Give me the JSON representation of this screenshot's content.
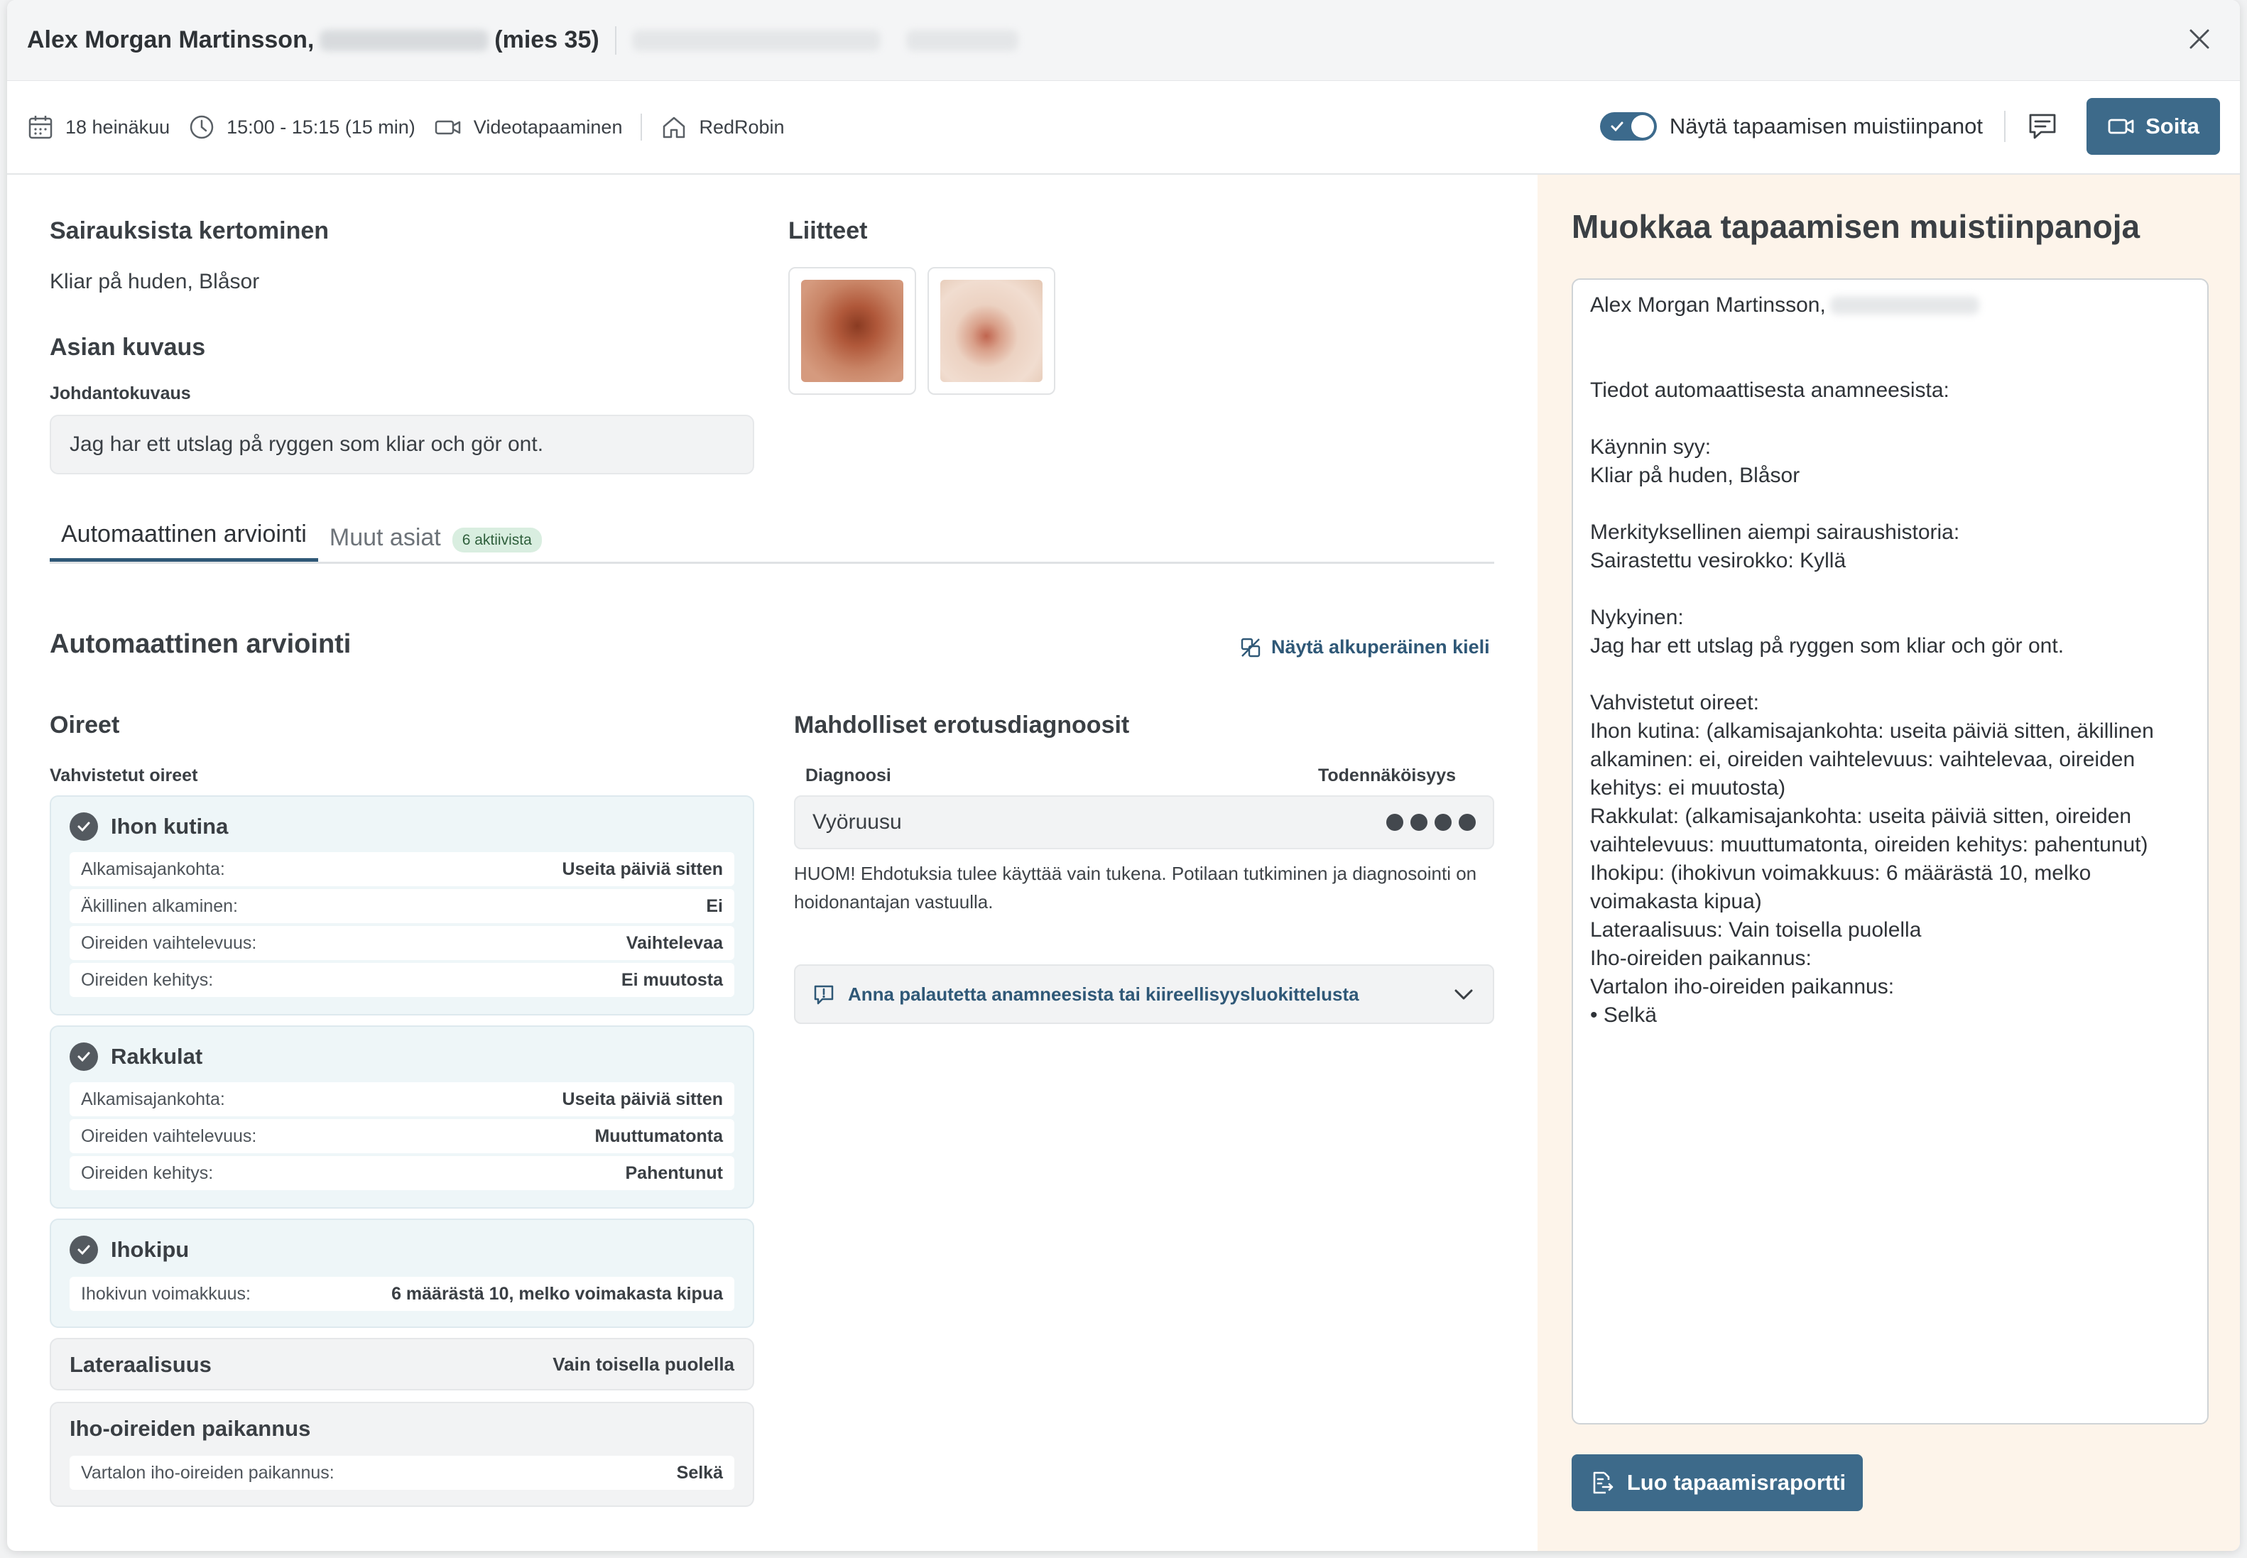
{
  "header": {
    "patient_name": "Alex Morgan Martinsson,",
    "patient_age": "(mies 35)",
    "close_label": "×"
  },
  "meta": {
    "date": "18 heinäkuu",
    "time": "15:00 - 15:15 (15 min)",
    "type": "Videotapaaminen",
    "location": "RedRobin",
    "toggle_label": "Näytä tapaamisen muistiinpanot",
    "toggle_on": true,
    "call_label": "Soita"
  },
  "reason": {
    "title": "Sairauksista kertominen",
    "value": "Kliar på huden, Blåsor"
  },
  "attachments": {
    "title": "Liitteet"
  },
  "description": {
    "title": "Asian kuvaus",
    "intro_label": "Johdantokuvaus",
    "intro_text": "Jag har ett utslag på ryggen som kliar och gör ont."
  },
  "tabs": {
    "active": "Automaattinen arviointi",
    "other": "Muut asiat",
    "badge": "6 aktiivista"
  },
  "assessment": {
    "title": "Automaattinen arviointi",
    "original_language_link": "Näytä alkuperäinen kieli",
    "symptoms_title": "Oireet",
    "confirmed_label": "Vahvistetut oireet",
    "symptoms": [
      {
        "name": "Ihon kutina",
        "rows": [
          {
            "k": "Alkamisajankohta:",
            "v": "Useita päiviä sitten"
          },
          {
            "k": "Äkillinen alkaminen:",
            "v": "Ei"
          },
          {
            "k": "Oireiden vaihtelevuus:",
            "v": "Vaihtelevaa"
          },
          {
            "k": "Oireiden kehitys:",
            "v": "Ei muutosta"
          }
        ]
      },
      {
        "name": "Rakkulat",
        "rows": [
          {
            "k": "Alkamisajankohta:",
            "v": "Useita päiviä sitten"
          },
          {
            "k": "Oireiden vaihtelevuus:",
            "v": "Muuttumatonta"
          },
          {
            "k": "Oireiden kehitys:",
            "v": "Pahentunut"
          }
        ]
      },
      {
        "name": "Ihokipu",
        "rows": [
          {
            "k": "Ihokivun voimakkuus:",
            "v": "6 määrästä 10, melko voimakasta kipua"
          }
        ]
      }
    ],
    "laterality": {
      "name": "Lateraalisuus",
      "value": "Vain toisella puolella"
    },
    "location": {
      "name": "Iho-oireiden paikannus",
      "rows": [
        {
          "k": "Vartalon iho-oireiden paikannus:",
          "v": "Selkä"
        }
      ]
    },
    "differential": {
      "title": "Mahdolliset erotusdiagnoosit",
      "col_diagnosis": "Diagnoosi",
      "col_probability": "Todennäköisyys",
      "items": [
        {
          "name": "Vyöruusu",
          "probability_dots": 4
        }
      ],
      "disclaimer": "HUOM! Ehdotuksia tulee käyttää vain tukena. Potilaan tutkiminen ja diagnosointi on hoidonantajan vastuulla.",
      "feedback_label": "Anna palautetta anamneesista tai kiireellisyysluokittelusta"
    }
  },
  "notes": {
    "title": "Muokkaa tapaamisen muistiinpanoja",
    "name_line": "Alex Morgan Martinsson,",
    "body": "Tiedot automaattisesta anamneesista:\n\nKäynnin syy:\nKliar på huden, Blåsor\n\nMerkityksellinen aiempi sairaushistoria:\nSairastettu vesirokko: Kyllä\n\nNykyinen:\nJag har ett utslag på ryggen som kliar och gör ont.\n\nVahvistetut oireet:\nIhon kutina: (alkamisajankohta: useita päiviä sitten, äkillinen alkaminen: ei, oireiden vaihtelevuus: vaihtelevaa, oireiden kehitys: ei muutosta)\nRakkulat: (alkamisajankohta: useita päiviä sitten, oireiden vaihtelevuus: muuttumatonta, oireiden kehitys: pahentunut)\nIhokipu: (ihokivun voimakkuus: 6 määrästä 10, melko voimakasta kipua)\nLateraalisuus: Vain toisella puolella\nIho-oireiden paikannus:\nVartalon iho-oireiden paikannus:\n• Selkä",
    "report_button": "Luo tapaamisraportti"
  }
}
